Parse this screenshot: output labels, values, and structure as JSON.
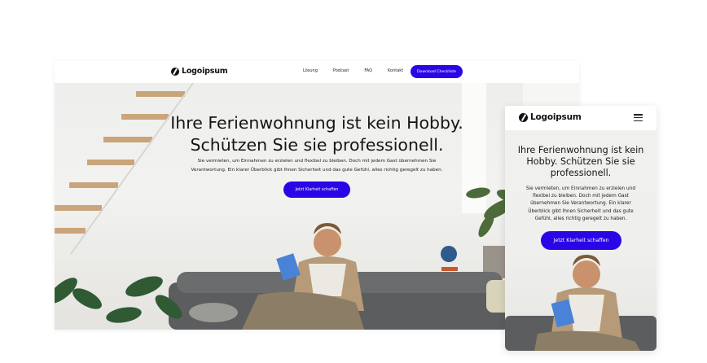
{
  "desktop": {
    "logo": "Logoipsum",
    "nav_links": [
      "Lösung",
      "Podcast",
      "FAQ",
      "Kontakt"
    ],
    "cta_label": "Download Checkliste",
    "hero": {
      "title_line1": "Ihre Ferienwohnung ist kein Hobby.",
      "title_line2": "Schützen Sie sie professionell.",
      "sub_line1": "Sie vermieten, um Einnahmen zu erzielen und flexibel zu bleiben. Doch mit jedem Gast übernehmen Sie",
      "sub_line2": "Verantwortung. Ein klarer Überblick gibt Ihnen Sicherheit und das gute Gefühl, alles richtig geregelt zu haben.",
      "button_label": "Jetzt Klarheit schaffen"
    }
  },
  "mobile": {
    "logo": "Logoipsum",
    "menu_icon": "hamburger-icon",
    "hero": {
      "title_line1": "Ihre Ferienwohnung ist kein",
      "title_line2": "Hobby. Schützen Sie sie",
      "title_line3": "professionell.",
      "sub_line1": "Sie vermieten, um Einnahmen zu erzielen und",
      "sub_line2": "flexibel zu bleiben. Doch mit jedem Gast",
      "sub_line3": "übernehmen Sie Verantwortung. Ein klarer",
      "sub_line4": "Überblick gibt Ihnen Sicherheit und das gute",
      "sub_line5": "Gefühl, alles richtig geregelt zu haben.",
      "button_label": "Jetzt Klarheit schaffen"
    }
  },
  "colors": {
    "accent": "#2a06e6",
    "background": "#ffffff",
    "hero_bg": "#efefed"
  }
}
